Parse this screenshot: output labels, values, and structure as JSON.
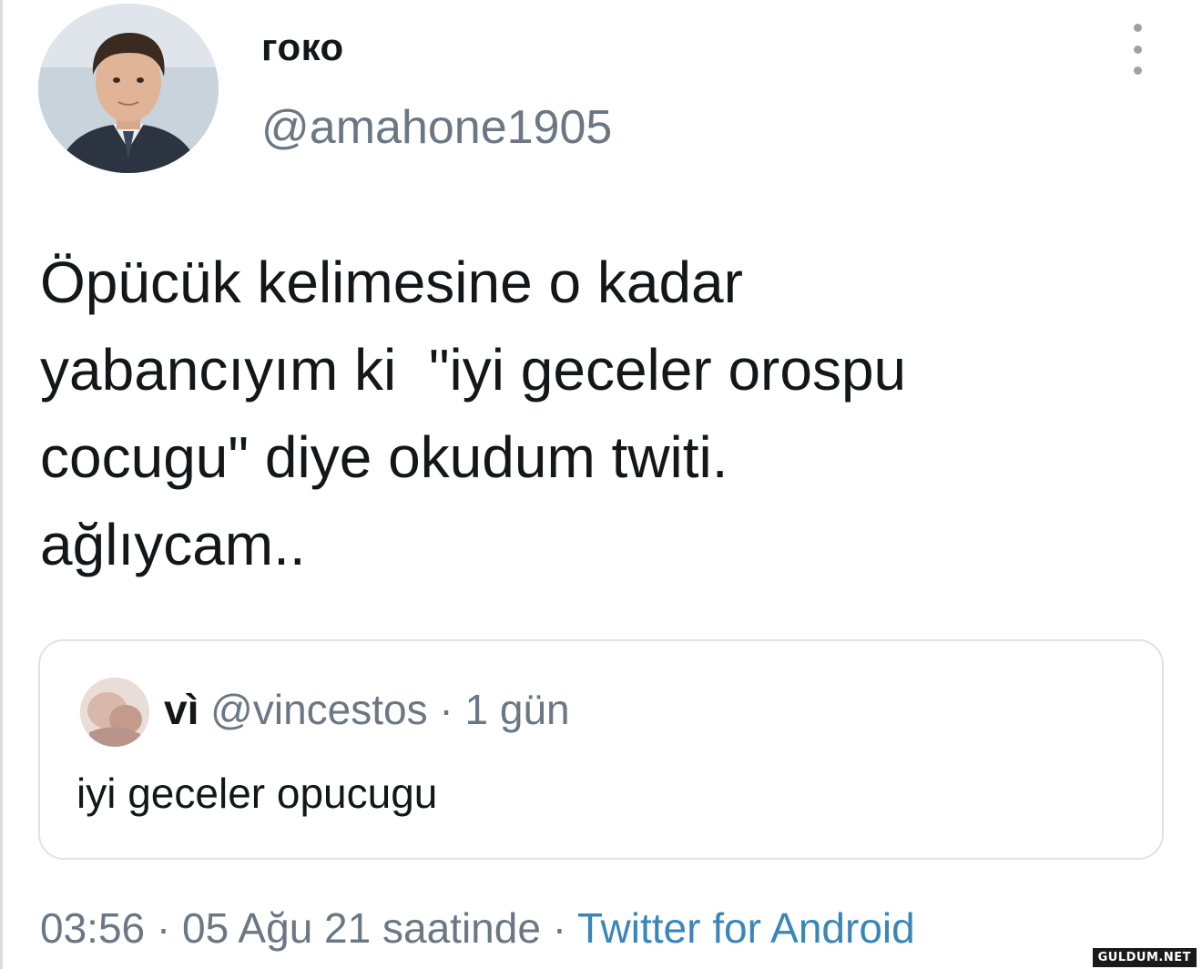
{
  "author": {
    "name": "гоко",
    "handle": "@amahone1905"
  },
  "tweet": {
    "text": "Öpücük kelimesine o kadar\nyabancıyım ki  \"iyi geceler orospu\ncocugu\" diye okudum twiti.\nağlıycam.."
  },
  "quoted_tweet": {
    "name": "vì",
    "handle": "@vincestos",
    "separator": "·",
    "time": "1 gün",
    "text": "iyi geceler opucugu"
  },
  "meta": {
    "time": "03:56",
    "separator": "·",
    "date": "05 Ağu 21 saatinde",
    "separator2": "·",
    "source": "Twitter for Android"
  },
  "icons": {
    "more": "more-vertical-icon"
  },
  "colors": {
    "text": "#14171a",
    "secondary": "#6b7784",
    "link": "#3a86b8",
    "border": "#dfe3e7"
  },
  "watermark": "GULDUM.NET"
}
